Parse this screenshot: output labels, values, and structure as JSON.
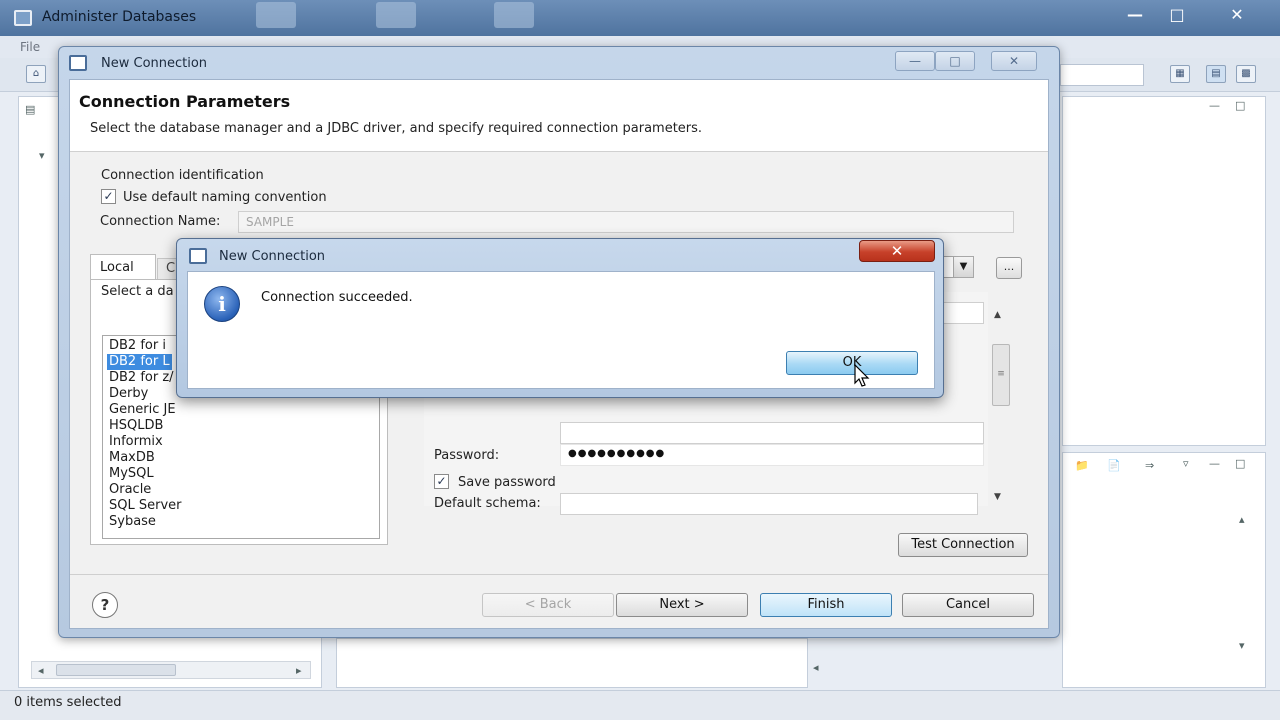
{
  "main_window": {
    "title": "Administer Databases",
    "menu": [
      "File"
    ],
    "status": "0 items selected"
  },
  "wizard": {
    "title": "New Connection",
    "heading": "Connection Parameters",
    "subtitle": "Select the database manager and a JDBC driver, and specify required connection parameters.",
    "connection_identification_label": "Connection identification",
    "use_default_naming_label": "Use default naming convention",
    "use_default_naming_checked": true,
    "connection_name_label": "Connection Name:",
    "connection_name_value": "SAMPLE",
    "tab_local": "Local",
    "tab_other": "C",
    "select_db_label": "Select a da",
    "db_list": [
      {
        "label": "DB2 for i",
        "selected": false
      },
      {
        "label": "DB2 for L",
        "selected": true
      },
      {
        "label": "DB2 for z/",
        "selected": false
      },
      {
        "label": "Derby",
        "selected": false
      },
      {
        "label": "Generic JE",
        "selected": false
      },
      {
        "label": "HSQLDB",
        "selected": false
      },
      {
        "label": "Informix",
        "selected": false
      },
      {
        "label": "MaxDB",
        "selected": false
      },
      {
        "label": "MySQL",
        "selected": false
      },
      {
        "label": "Oracle",
        "selected": false
      },
      {
        "label": "SQL Server",
        "selected": false
      },
      {
        "label": "Sybase",
        "selected": false
      }
    ],
    "jdbc_dots_label": "...",
    "password_label": "Password:",
    "password_value": "●●●●●●●●●●",
    "save_password_label": "Save password",
    "save_password_checked": true,
    "default_schema_label": "Default schema:",
    "default_schema_value": "",
    "test_connection_label": "Test Connection",
    "help_label": "?",
    "back_label": "< Back",
    "next_label": "Next >",
    "finish_label": "Finish",
    "cancel_label": "Cancel"
  },
  "message_box": {
    "title": "New Connection",
    "close_label": "✕",
    "info_glyph": "i",
    "message": "Connection succeeded.",
    "ok_label": "OK"
  }
}
